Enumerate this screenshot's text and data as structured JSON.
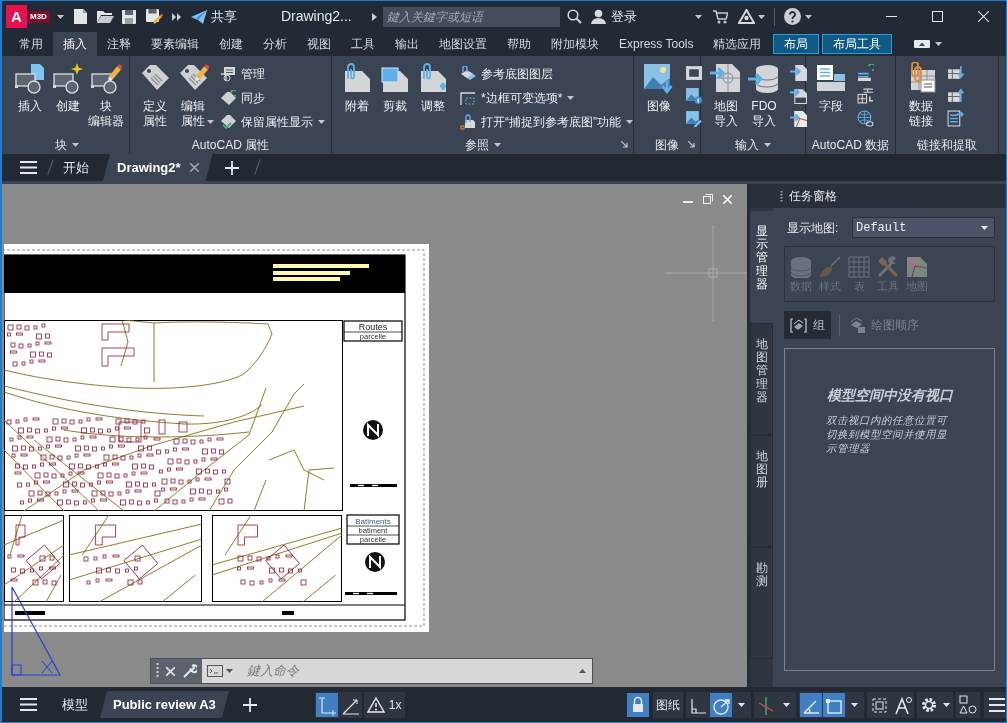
{
  "title_bar": {
    "logo_letter": "A",
    "logo_badge": "M3D",
    "share_label": "共享",
    "document_title": "Drawing2...",
    "search": {
      "placeholder": "鍵入关鍵字或短语"
    },
    "sign_in": "登录"
  },
  "ribbon": {
    "tabs": [
      {
        "label": "常用",
        "kind": "normal",
        "selected": false
      },
      {
        "label": "插入",
        "kind": "normal",
        "selected": true
      },
      {
        "label": "注释",
        "kind": "normal",
        "selected": false
      },
      {
        "label": "要素编辑",
        "kind": "normal",
        "selected": false
      },
      {
        "label": "创建",
        "kind": "normal",
        "selected": false
      },
      {
        "label": "分析",
        "kind": "normal",
        "selected": false
      },
      {
        "label": "视图",
        "kind": "normal",
        "selected": false
      },
      {
        "label": "工具",
        "kind": "normal",
        "selected": false
      },
      {
        "label": "输出",
        "kind": "normal",
        "selected": false
      },
      {
        "label": "地图设置",
        "kind": "normal",
        "selected": false
      },
      {
        "label": "帮助",
        "kind": "normal",
        "selected": false
      },
      {
        "label": "附加模块",
        "kind": "normal",
        "selected": false
      },
      {
        "label": "Express Tools",
        "kind": "normal",
        "selected": false
      },
      {
        "label": "精选应用",
        "kind": "normal",
        "selected": false
      },
      {
        "label": "布局",
        "kind": "contextual",
        "selected": false
      },
      {
        "label": "布局工具",
        "kind": "contextual",
        "selected": false
      }
    ],
    "panels": [
      {
        "title": "块",
        "menu": true,
        "large_buttons": [
          {
            "lines": [
              "插入"
            ]
          },
          {
            "lines": [
              "创建"
            ]
          },
          {
            "lines": [
              "块",
              "编辑器"
            ]
          }
        ]
      },
      {
        "title": "AutoCAD 属性",
        "large_buttons": [
          {
            "lines": [
              "定义",
              "属性"
            ]
          },
          {
            "lines": [
              "编辑",
              "属性"
            ],
            "dropdown": true
          }
        ],
        "small_buttons": [
          {
            "label": "管理"
          },
          {
            "label": "同步"
          },
          {
            "label": "保留属性显示",
            "dropdown": true
          }
        ]
      },
      {
        "title": "参照",
        "menu": true,
        "launcher": true,
        "large_buttons": [
          {
            "lines": [
              "附着"
            ]
          },
          {
            "lines": [
              "剪裁"
            ]
          },
          {
            "lines": [
              "调整"
            ]
          }
        ],
        "small_buttons": [
          {
            "label": "参考底图图层"
          },
          {
            "label": "*边框可变选项*",
            "dropdown": true
          },
          {
            "label": "打开“捕捉到参考底图”功能",
            "dropdown": true
          }
        ]
      },
      {
        "title": "图像",
        "launcher": true,
        "large_buttons": [
          {
            "lines": [
              "图像"
            ]
          }
        ]
      },
      {
        "title": "输入",
        "menu": true,
        "large_buttons": [
          {
            "lines": [
              "地图",
              "导入"
            ]
          },
          {
            "lines": [
              "FDO",
              "导入"
            ]
          }
        ]
      },
      {
        "title": "AutoCAD 数据",
        "large_buttons": [
          {
            "lines": [
              "字段"
            ]
          }
        ]
      },
      {
        "title": "链接和提取",
        "large_buttons": [
          {
            "lines": [
              "数据",
              "链接"
            ]
          }
        ]
      }
    ]
  },
  "document_tabs": [
    {
      "label": "开始",
      "selected": false
    },
    {
      "label": "Drawing2*",
      "selected": true,
      "closable": true
    }
  ],
  "viewport": {
    "sheet": {
      "legends": [
        {
          "title": "Routes",
          "items": [
            "parcelle"
          ]
        },
        {
          "title": "Batiments",
          "items": [
            "batiment",
            "parcelle"
          ]
        }
      ]
    },
    "command_line": {
      "placeholder": "鍵入命令"
    }
  },
  "task_pane": {
    "title": "任务窗格",
    "side_tabs": [
      {
        "label": "显示管理器",
        "selected": true
      },
      {
        "label": "地图管理器",
        "selected": false
      },
      {
        "label": "地图册",
        "selected": false
      },
      {
        "label": "勘测",
        "selected": false
      }
    ],
    "map_label": "显示地图:",
    "map_select": "Default",
    "tools": [
      {
        "label": "数据",
        "disabled": true
      },
      {
        "label": "样式",
        "disabled": true
      },
      {
        "label": "表",
        "disabled": true
      },
      {
        "label": "工具",
        "disabled": true
      },
      {
        "label": "地图",
        "disabled": true
      }
    ],
    "group_button": {
      "label": "组",
      "selected": true
    },
    "draw_order": {
      "label": "绘图顺序",
      "disabled": true
    },
    "message": {
      "title": "模型空间中没有视口",
      "body": "双击视口内的任意位置可切换到模型空间并使用显示管理器"
    }
  },
  "status_bar": {
    "layout_tabs": [
      {
        "label": "模型",
        "selected": false
      },
      {
        "label": "Public review A3",
        "selected": true
      }
    ],
    "toggles_left": [
      {
        "on": true
      },
      {
        "on": false
      }
    ],
    "annotation_scale": "1x",
    "lock": {
      "on": true
    },
    "paper_label": "图纸",
    "toggles_right": [
      {
        "on": false
      },
      {
        "on": true
      },
      {
        "on": false
      },
      {
        "on": true
      },
      {
        "on": true
      },
      {
        "on": false
      },
      {
        "on": false
      }
    ]
  }
}
